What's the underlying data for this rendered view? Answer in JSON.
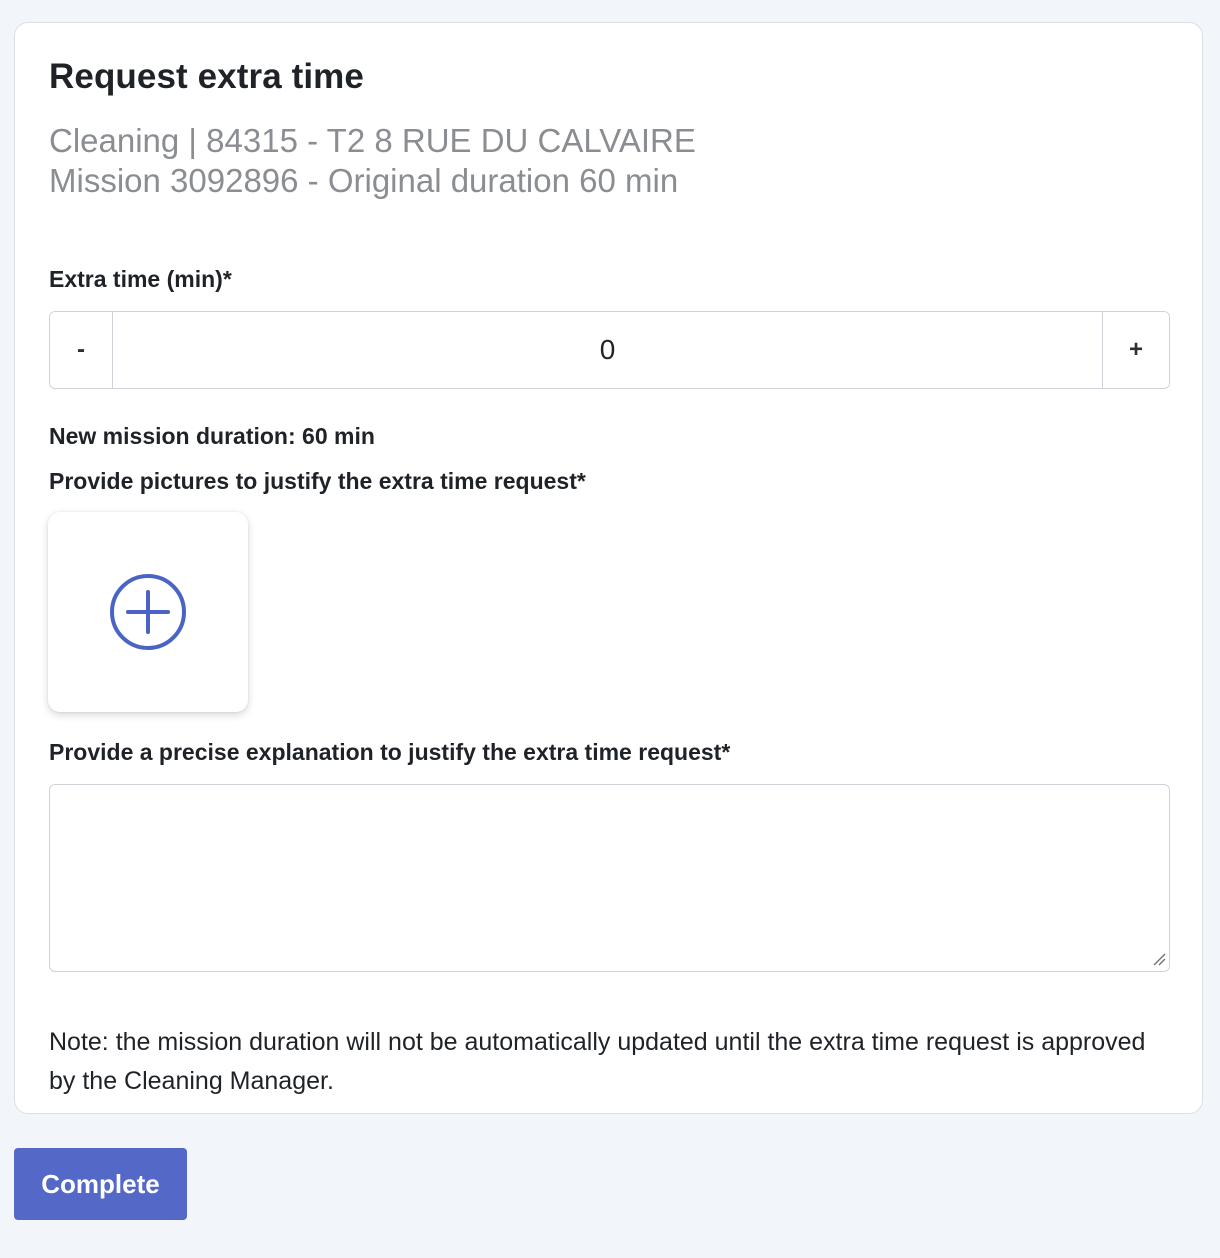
{
  "form": {
    "title": "Request extra time",
    "subtitle_line1": "Cleaning | 84315 - T2 8 RUE DU CALVAIRE",
    "subtitle_line2": "Mission 3092896 - Original duration 60 min",
    "extra_time_label": "Extra time (min)*",
    "stepper": {
      "decrement_label": "-",
      "value": "0",
      "increment_label": "+"
    },
    "new_duration_text": "New mission duration: 60 min",
    "pictures_label": "Provide pictures to justify the extra time request*",
    "add_photo_icon": "plus-circle-icon",
    "explanation_label": "Provide a precise explanation to justify the extra time request*",
    "explanation_value": "",
    "note": "Note: the mission duration will not be automatically updated until the extra time request is approved by the Cleaning Manager."
  },
  "actions": {
    "complete_label": "Complete"
  },
  "colors": {
    "accent": "#5468c8",
    "icon_blue": "#4b63c4",
    "background": "#f2f5fa",
    "muted_text": "#8a8d91"
  }
}
